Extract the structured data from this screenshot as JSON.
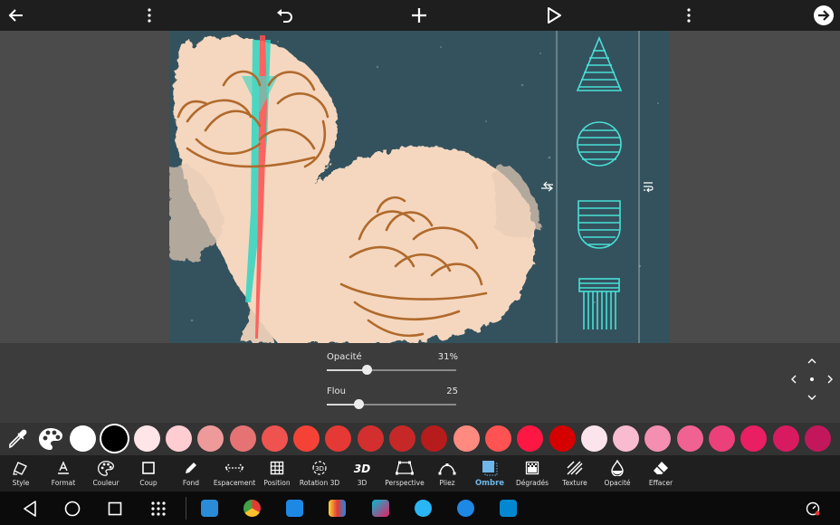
{
  "toolbar": {
    "back_icon": "arrow-left-icon",
    "menu_icon": "more-vertical-icon",
    "undo_icon": "undo-icon",
    "add_icon": "plus-icon",
    "play_icon": "play-icon",
    "overflow_icon": "more-vertical-icon",
    "next_icon": "arrow-right-circle-icon"
  },
  "adjustments": {
    "opacity": {
      "label": "Opacité",
      "value_text": "31%",
      "value": 0.31
    },
    "blur": {
      "label": "Flou",
      "value_text": "25",
      "value": 0.25
    }
  },
  "palette": {
    "eyedropper_icon": "eyedropper-icon",
    "palette_icon": "palette-icon",
    "colors": [
      "#ffffff",
      "#000000",
      "#ffe4e8",
      "#fecdd2",
      "#ef9a9a",
      "#e57373",
      "#ef5350",
      "#f44336",
      "#e53935",
      "#d32f2f",
      "#c62828",
      "#b71c1c",
      "#ff8a80",
      "#ff5252",
      "#ff1744",
      "#d50000",
      "#fce4ec",
      "#f8bbd0",
      "#f48fb1",
      "#f06292",
      "#ec407a",
      "#e91e63",
      "#d81b60",
      "#c2185b"
    ],
    "selected_index": 1
  },
  "tools": [
    {
      "label": "Style",
      "icon": "style-icon"
    },
    {
      "label": "Format",
      "icon": "text-format-icon"
    },
    {
      "label": "Couleur",
      "icon": "palette-icon"
    },
    {
      "label": "Coup",
      "icon": "stroke-square-icon"
    },
    {
      "label": "Fond",
      "icon": "pencil-icon"
    },
    {
      "label": "Espacement",
      "icon": "spacing-icon"
    },
    {
      "label": "Position",
      "icon": "grid-icon"
    },
    {
      "label": "Rotation 3D",
      "icon": "rotation-3d-icon"
    },
    {
      "label": "3D",
      "icon": "3d-icon"
    },
    {
      "label": "Perspective",
      "icon": "perspective-icon"
    },
    {
      "label": "Pliez",
      "icon": "curve-icon"
    },
    {
      "label": "Ombre",
      "icon": "shadow-icon"
    },
    {
      "label": "Dégradés",
      "icon": "gradient-icon"
    },
    {
      "label": "Texture",
      "icon": "texture-icon"
    },
    {
      "label": "Opacité",
      "icon": "opacity-drop-icon"
    },
    {
      "label": "Effacer",
      "icon": "eraser-icon"
    }
  ],
  "active_tool": "Ombre",
  "tool_icon_text": {
    "three_d": "3D",
    "rotation_3d": "3D"
  },
  "navbar": {
    "back": "nav-back-icon",
    "home": "nav-home-icon",
    "recents": "nav-recents-icon",
    "apps": "app-drawer-icon",
    "apps_pinned": [
      "app-1-icon",
      "chrome-icon",
      "app-3-icon",
      "app-4-icon",
      "app-5-icon",
      "app-6-icon",
      "app-7-icon",
      "app-8-icon"
    ]
  }
}
